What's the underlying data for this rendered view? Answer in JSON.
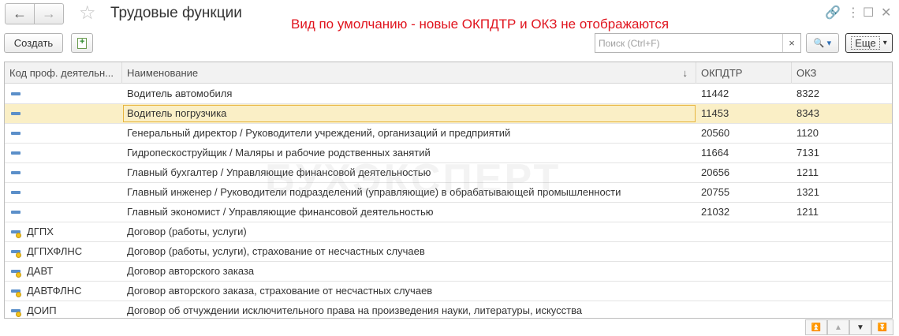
{
  "window": {
    "title": "Трудовые функции",
    "notice": "Вид по умолчанию - новые ОКПДТР и ОКЗ не отображаются",
    "back_icon": "←",
    "forward_icon": "→",
    "star_icon": "☆",
    "link_icon": "🔗",
    "menu_icon": "⋮",
    "maximize_icon": "☐",
    "close_icon": "✕"
  },
  "toolbar": {
    "create_label": "Создать",
    "search_placeholder": "Поиск (Ctrl+F)",
    "search_value": "",
    "clear_icon": "×",
    "search_btn_label": "🔍 ▾",
    "more_label": "Еще",
    "more_arrow": "▾"
  },
  "table": {
    "columns": [
      "Код проф. деятельн...",
      "Наименование",
      "ОКПДТР",
      "ОКЗ"
    ],
    "sort_icon": "↓",
    "rows": [
      {
        "type": "group",
        "code": "",
        "name": "Водитель автомобиля",
        "okpdtr": "11442",
        "okz": "8322"
      },
      {
        "type": "group",
        "code": "",
        "name": "Водитель погрузчика",
        "okpdtr": "11453",
        "okz": "8343",
        "selected": true
      },
      {
        "type": "group",
        "code": "",
        "name": "Генеральный директор / Руководители учреждений, организаций и предприятий",
        "okpdtr": "20560",
        "okz": "1120"
      },
      {
        "type": "group",
        "code": "",
        "name": "Гидропескоструйщик / Маляры и рабочие родственных занятий",
        "okpdtr": "11664",
        "okz": "7131"
      },
      {
        "type": "group",
        "code": "",
        "name": "Главный бухгалтер / Управляющие финансовой деятельностью",
        "okpdtr": "20656",
        "okz": "1211"
      },
      {
        "type": "group",
        "code": "",
        "name": "Главный инженер / Руководители подразделений (управляющие) в обрабатывающей промышленности",
        "okpdtr": "20755",
        "okz": "1321"
      },
      {
        "type": "group",
        "code": "",
        "name": "Главный экономист / Управляющие финансовой деятельностью",
        "okpdtr": "21032",
        "okz": "1211"
      },
      {
        "type": "item",
        "code": "ДГПХ",
        "name": "Договор (работы, услуги)",
        "okpdtr": "",
        "okz": ""
      },
      {
        "type": "item",
        "code": "ДГПХФЛНС",
        "name": "Договор (работы, услуги), страхование от несчастных случаев",
        "okpdtr": "",
        "okz": ""
      },
      {
        "type": "item",
        "code": "ДАВТ",
        "name": "Договор авторского заказа",
        "okpdtr": "",
        "okz": ""
      },
      {
        "type": "item",
        "code": "ДАВТФЛНС",
        "name": "Договор авторского заказа, страхование от несчастных случаев",
        "okpdtr": "",
        "okz": ""
      },
      {
        "type": "item",
        "code": "ДОИП",
        "name": "Договор об отчуждении исключительного права на произведения науки, литературы, искусства",
        "okpdtr": "",
        "okz": ""
      }
    ]
  },
  "watermark": "БУХЭКСПЕРТ",
  "scroll": {
    "first": "⏫",
    "up": "▲",
    "down": "▼",
    "last": "⏬"
  },
  "colors": {
    "notice": "#e0141e",
    "selected_row": "#faefc6",
    "selected_border": "#e7b53f",
    "group_icon": "#5b8fc9",
    "item_icon_dot": "#f5c31d"
  }
}
